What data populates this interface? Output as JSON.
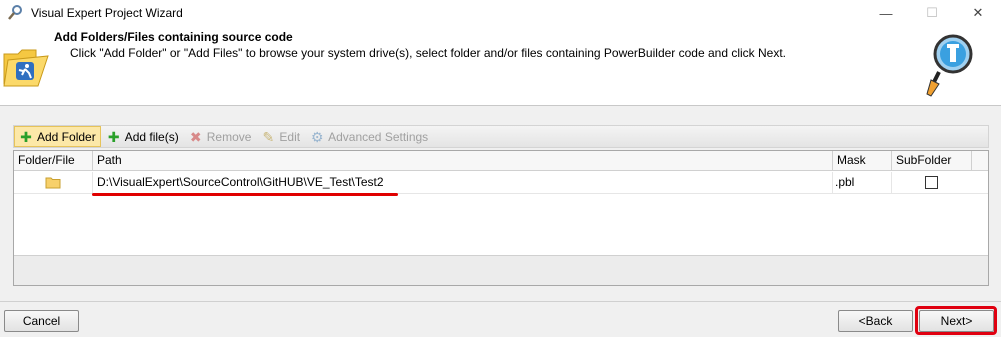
{
  "window": {
    "title": "Visual Expert Project Wizard",
    "minimize": "—",
    "maximize": "☐",
    "close": "✕"
  },
  "header": {
    "title": "Add Folders/Files containing source code",
    "description": "Click \"Add Folder\" or \"Add Files\" to browse your system drive(s), select folder and/or files containing PowerBuilder code and click Next."
  },
  "toolbar": {
    "add_folder": "Add Folder",
    "add_files": "Add file(s)",
    "remove": "Remove",
    "edit": "Edit",
    "advanced_settings": "Advanced Settings"
  },
  "grid": {
    "columns": {
      "folder_file": "Folder/File",
      "path": "Path",
      "mask": "Mask",
      "subfolder": "SubFolder"
    },
    "rows": [
      {
        "type_icon": "folder-icon",
        "path": "D:\\VisualExpert\\SourceControl\\GitHUB\\VE_Test\\Test2",
        "mask": ".pbl",
        "subfolder": false
      }
    ]
  },
  "buttons": {
    "cancel": "Cancel",
    "back": "<Back",
    "next": "Next>"
  },
  "colors": {
    "highlight": "#e00010",
    "add_green": "#2aa02a",
    "active_toolbar": "#fce8a8"
  }
}
